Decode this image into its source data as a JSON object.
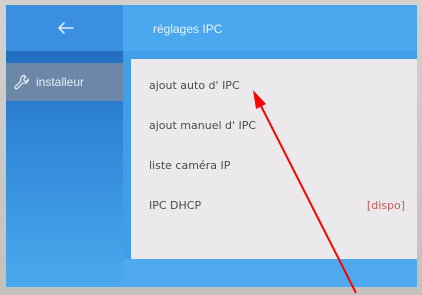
{
  "header": {
    "title": "réglages IPC",
    "back_icon": "arrow-left-icon"
  },
  "sidebar": {
    "items": [
      {
        "label": "installeur",
        "icon": "wrench-icon"
      }
    ]
  },
  "menu": {
    "items": [
      {
        "label": "ajout auto d' IPC"
      },
      {
        "label": "ajout manuel d' IPC"
      },
      {
        "label": "liste caméra IP"
      },
      {
        "label": "IPC DHCP",
        "status": "[dispo]"
      }
    ]
  },
  "colors": {
    "accent": "#3f9ee6",
    "status": "#c45a5a",
    "annotation": "#ff0000"
  }
}
